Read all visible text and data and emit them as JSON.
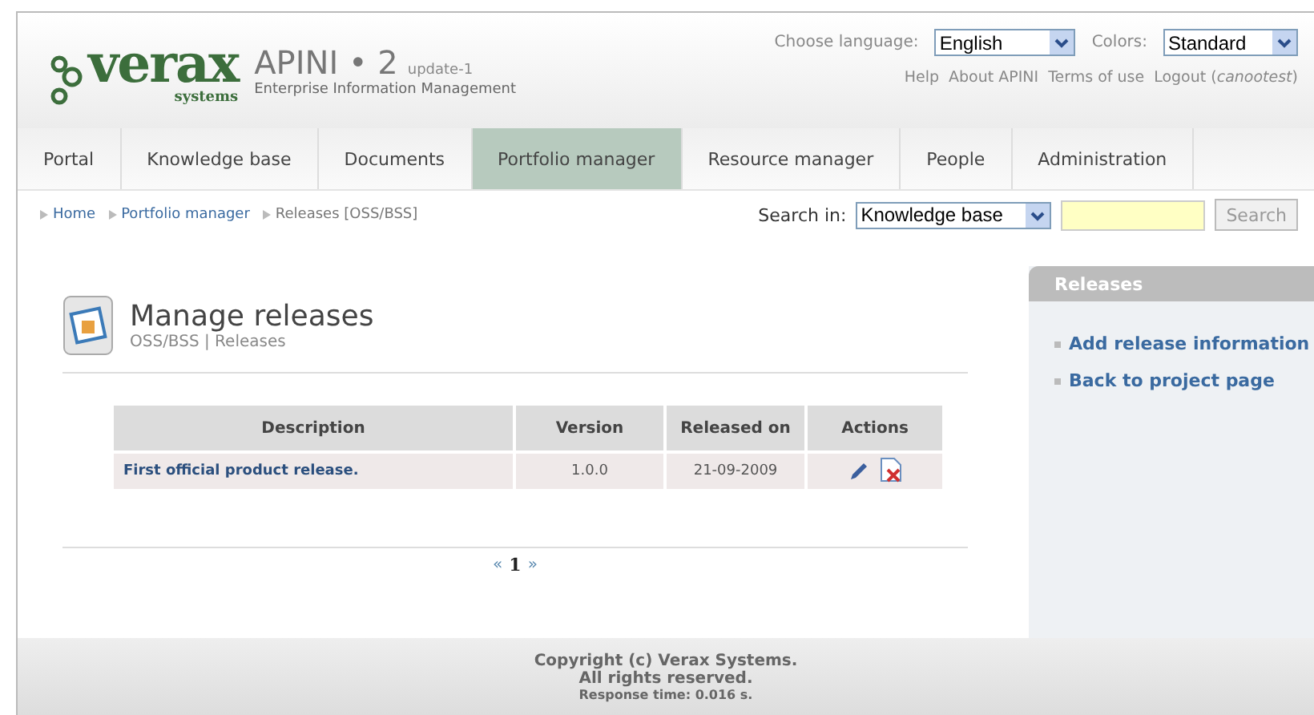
{
  "logo": {
    "wordmark": "verax",
    "tagline": "systems"
  },
  "product": {
    "name": "APINI • 2",
    "edition": "update-1",
    "subtitle": "Enterprise Information Management"
  },
  "preferences": [
    {
      "label": "Choose language:",
      "value": "English"
    },
    {
      "label": "Colors:",
      "value": "Standard"
    }
  ],
  "top_links": [
    {
      "text": "Help"
    },
    {
      "text": "About APINI"
    },
    {
      "text": "Terms of use"
    },
    {
      "text": "Logout (*canootest*)"
    }
  ],
  "nav_tabs": [
    {
      "label": "Portal",
      "selected": false
    },
    {
      "label": "Knowledge base",
      "selected": false
    },
    {
      "label": "Documents",
      "selected": false
    },
    {
      "label": "Portfolio manager",
      "selected": true
    },
    {
      "label": "Resource manager",
      "selected": false
    },
    {
      "label": "People",
      "selected": false
    },
    {
      "label": "Administration",
      "selected": false
    }
  ],
  "breadcrumbs": [
    {
      "text": "Home",
      "link": true
    },
    {
      "text": "Portfolio manager",
      "link": true
    },
    {
      "text": "Releases [OSS/BSS]",
      "link": false
    }
  ],
  "search": {
    "label": "Search in:",
    "scope": "Knowledge base",
    "button": "Search"
  },
  "page": {
    "title": "Manage releases",
    "subtitle": "OSS/BSS | Releases"
  },
  "table": {
    "columns": [
      "Description",
      "Version",
      "Released on",
      "Actions"
    ],
    "rows": [
      {
        "description": "First official product release.",
        "version": "1.0.0",
        "released_on": "21-09-2009"
      }
    ]
  },
  "pager": {
    "prev": "«",
    "page": "1",
    "next": "»"
  },
  "sidebar": {
    "title": "Releases",
    "links": [
      "Add release information",
      "Back to project page"
    ]
  },
  "footer": {
    "copyright": "Copyright (c) Verax Systems.",
    "rights": "All rights reserved.",
    "response_time": "Response time: 0.016 s."
  }
}
